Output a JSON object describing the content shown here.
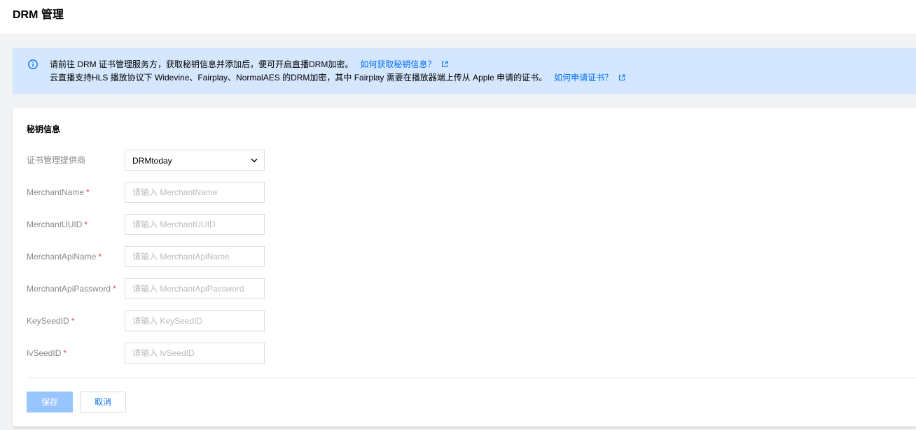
{
  "header": {
    "title": "DRM 管理"
  },
  "notice": {
    "line1_text": "请前往 DRM 证书管理服务方，获取秘钥信息并添加后，便可开启直播DRM加密。",
    "line1_link": "如何获取秘钥信息？",
    "line2_text": "云直播支持HLS 播放协议下 Widevine、Fairplay、NormalAES 的DRM加密，其中 Fairplay 需要在播放器端上传从 Apple 申请的证书。",
    "line2_link": "如何申请证书？",
    "icon": "info-icon",
    "link_icon": "external-link-icon"
  },
  "form": {
    "section_title": "秘钥信息",
    "provider": {
      "label": "证书管理提供商",
      "value": "DRMtoday"
    },
    "required_mark": "*",
    "fields": [
      {
        "label": "MerchantName",
        "placeholder": "请输入 MerchantName",
        "value": ""
      },
      {
        "label": "MerchantUUID",
        "placeholder": "请输入 MerchantUUID",
        "value": ""
      },
      {
        "label": "MerchantApiName",
        "placeholder": "请输入 MerchantApiName",
        "value": ""
      },
      {
        "label": "MerchantApiPassword",
        "placeholder": "请输入 MerchantApiPassword",
        "value": ""
      },
      {
        "label": "KeySeedID",
        "placeholder": "请输入 KeySeedID",
        "value": ""
      },
      {
        "label": "IvSeedID",
        "placeholder": "请输入 IvSeedID",
        "value": ""
      }
    ]
  },
  "actions": {
    "save_label": "保存",
    "cancel_label": "取消"
  },
  "colors": {
    "accent": "#006eff",
    "notice_bg": "#d5e7fe",
    "disabled_primary": "#99c5ff",
    "required": "#e54545"
  }
}
